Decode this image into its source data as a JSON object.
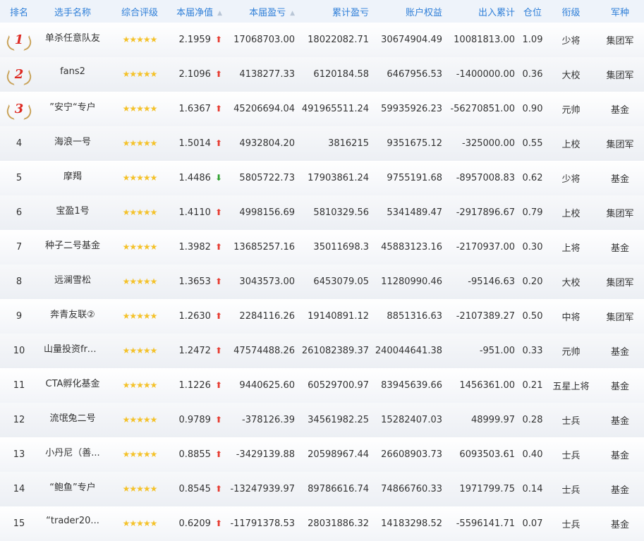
{
  "headers": {
    "rank": "排名",
    "name": "选手名称",
    "rating": "综合评级",
    "nav": "本届净值",
    "pnl": "本届盈亏",
    "cum": "累计盈亏",
    "equity": "账户权益",
    "io": "出入累计",
    "position": "仓位",
    "level": "衔级",
    "type": "军种"
  },
  "icons": {
    "sort": "sort-icon",
    "rating": "star-icon",
    "up": "arrow-up-icon",
    "down": "arrow-down-icon",
    "medal": "winged-medal-icon"
  },
  "colors": {
    "header_text": "#2f7fd8",
    "up": "#e63b30",
    "down": "#2fa02f",
    "star": "#f4c22b"
  },
  "rating_stars": 5,
  "rows": [
    {
      "rank": "1",
      "name": "单杀任意队友",
      "nav": "2.1959",
      "trend": "up",
      "pnl": "17068703.00",
      "cum": "18022082.71",
      "equity": "30674904.49",
      "io": "10081813.00",
      "position": "1.09",
      "level": "少将",
      "type": "集团军"
    },
    {
      "rank": "2",
      "name": "fans2",
      "nav": "2.1096",
      "trend": "up",
      "pnl": "4138277.33",
      "cum": "6120184.58",
      "equity": "6467956.53",
      "io": "-1400000.00",
      "position": "0.36",
      "level": "大校",
      "type": "集团军"
    },
    {
      "rank": "3",
      "name": "”安宁“专户",
      "nav": "1.6367",
      "trend": "up",
      "pnl": "45206694.04",
      "cum": "491965511.24",
      "equity": "59935926.23",
      "io": "-56270851.00",
      "position": "0.90",
      "level": "元帅",
      "type": "基金"
    },
    {
      "rank": "4",
      "name": "海浪一号",
      "nav": "1.5014",
      "trend": "up",
      "pnl": "4932804.20",
      "cum": "3816215",
      "equity": "9351675.12",
      "io": "-325000.00",
      "position": "0.55",
      "level": "上校",
      "type": "集团军"
    },
    {
      "rank": "5",
      "name": "摩羯",
      "nav": "1.4486",
      "trend": "down",
      "pnl": "5805722.73",
      "cum": "17903861.24",
      "equity": "9755191.68",
      "io": "-8957008.83",
      "position": "0.62",
      "level": "少将",
      "type": "基金"
    },
    {
      "rank": "6",
      "name": "宝盈1号",
      "nav": "1.4110",
      "trend": "up",
      "pnl": "4998156.69",
      "cum": "5810329.56",
      "equity": "5341489.47",
      "io": "-2917896.67",
      "position": "0.79",
      "level": "上校",
      "type": "集团军"
    },
    {
      "rank": "7",
      "name": "种子二号基金",
      "nav": "1.3982",
      "trend": "up",
      "pnl": "13685257.16",
      "cum": "35011698.3",
      "equity": "45883123.16",
      "io": "-2170937.00",
      "position": "0.30",
      "level": "上将",
      "type": "基金"
    },
    {
      "rank": "8",
      "name": "远澜雪松",
      "nav": "1.3653",
      "trend": "up",
      "pnl": "3043573.00",
      "cum": "6453079.05",
      "equity": "11280990.46",
      "io": "-95146.63",
      "position": "0.20",
      "level": "大校",
      "type": "集团军"
    },
    {
      "rank": "9",
      "name": "奔青友联②",
      "nav": "1.2630",
      "trend": "up",
      "pnl": "2284116.26",
      "cum": "19140891.12",
      "equity": "8851316.63",
      "io": "-2107389.27",
      "position": "0.50",
      "level": "中将",
      "type": "集团军"
    },
    {
      "rank": "10",
      "name": "山量投资fre...",
      "nav": "1.2472",
      "trend": "up",
      "pnl": "47574488.26",
      "cum": "261082389.37",
      "equity": "240044641.38",
      "io": "-951.00",
      "position": "0.33",
      "level": "元帅",
      "type": "基金"
    },
    {
      "rank": "11",
      "name": "CTA孵化基金",
      "nav": "1.1226",
      "trend": "up",
      "pnl": "9440625.60",
      "cum": "60529700.97",
      "equity": "83945639.66",
      "io": "1456361.00",
      "position": "0.21",
      "level": "五星上将",
      "type": "基金"
    },
    {
      "rank": "12",
      "name": "流氓兔二号",
      "nav": "0.9789",
      "trend": "up",
      "pnl": "-378126.39",
      "cum": "34561982.25",
      "equity": "15282407.03",
      "io": "48999.97",
      "position": "0.28",
      "level": "士兵",
      "type": "基金"
    },
    {
      "rank": "13",
      "name": "小丹尼（善...",
      "nav": "0.8855",
      "trend": "up",
      "pnl": "-3429139.88",
      "cum": "20598967.44",
      "equity": "26608903.73",
      "io": "6093503.61",
      "position": "0.40",
      "level": "士兵",
      "type": "基金"
    },
    {
      "rank": "14",
      "name": "“鲍鱼”专户",
      "nav": "0.8545",
      "trend": "up",
      "pnl": "-13247939.97",
      "cum": "89786616.74",
      "equity": "74866760.33",
      "io": "1971799.75",
      "position": "0.14",
      "level": "士兵",
      "type": "基金"
    },
    {
      "rank": "15",
      "name": "“trader20...",
      "nav": "0.6209",
      "trend": "up",
      "pnl": "-11791378.53",
      "cum": "28031886.32",
      "equity": "14183298.52",
      "io": "-5596141.71",
      "position": "0.07",
      "level": "士兵",
      "type": "基金"
    }
  ]
}
